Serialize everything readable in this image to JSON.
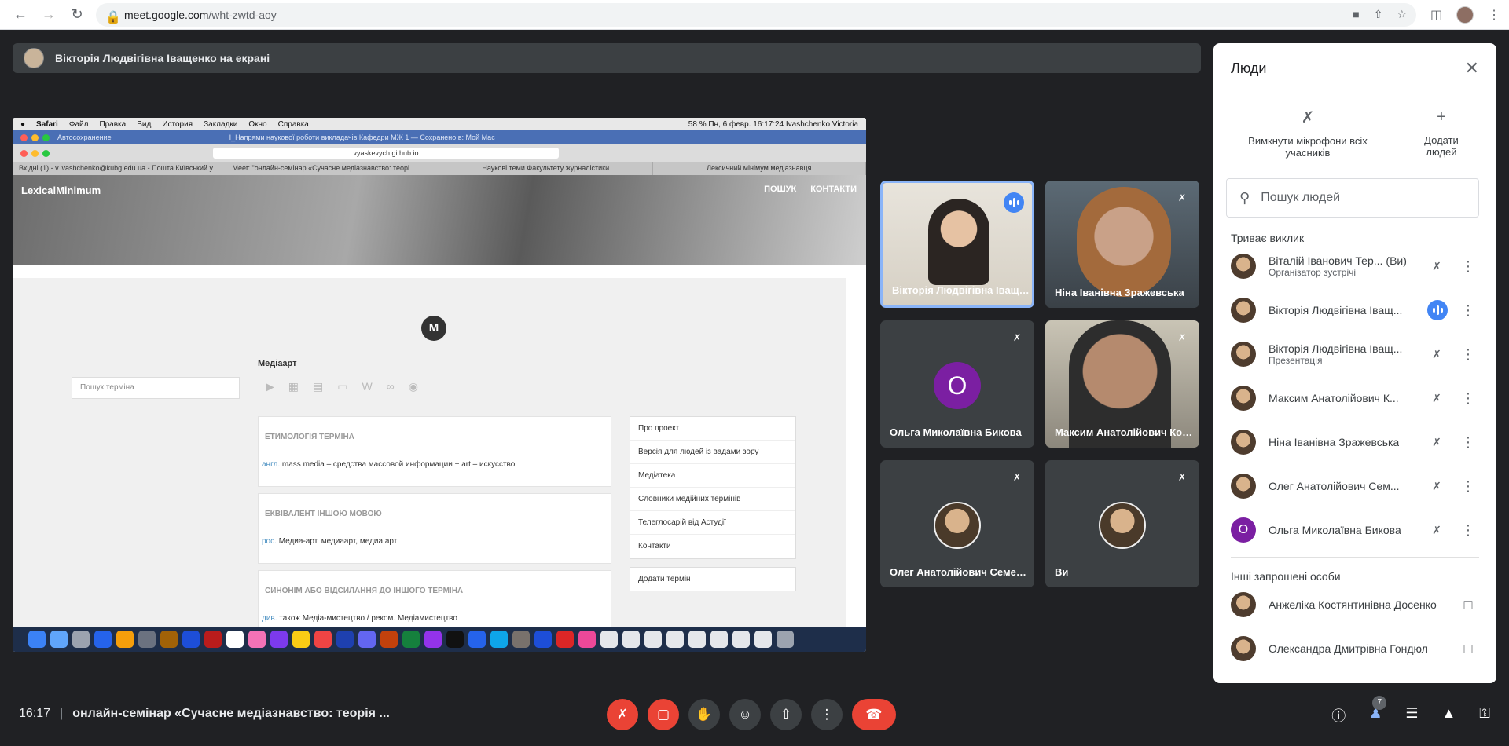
{
  "browser": {
    "url_host": "meet.google.com",
    "url_path": "/wht-zwtd-aoy"
  },
  "presenter": {
    "label": "Вікторія Людвігівна Іващенко на екрані"
  },
  "shared_screen": {
    "mac_menu": [
      "Safari",
      "Файл",
      "Правка",
      "Вид",
      "История",
      "Закладки",
      "Окно",
      "Справка"
    ],
    "mac_status": "58 %   Пн, 6 февр.  16:17:24   Ivashchenko Victoria",
    "doc_title": "І_Напрями наукової роботи викладачів Кафедри МЖ 1 — Сохранено в: Мой Mac",
    "autosave": "Автосохранение",
    "address": "vyaskevych.github.io",
    "tabs": [
      "Вхідні (1) - v.ivashchenko@kubg.edu.ua - Пошта Київський у...",
      "Meet: \"онлайн-семінар «Сучасне медіазнавство: теорі...",
      "Наукові теми Факультету журналістики",
      "Лексичний мінімум медіазнавця"
    ],
    "site_brand": "LexicalMinimum",
    "site_nav": [
      "ПОШУК",
      "КОНТАКТИ"
    ],
    "term_search_placeholder": "Пошук терміна",
    "avatar_letter": "M",
    "term_title": "Медіаарт",
    "cards": [
      {
        "heading": "ЕТИМОЛОГІЯ ТЕРМІНА",
        "lang": "англ.",
        "text": "mass media – средства массовой информации + art – искусство"
      },
      {
        "heading": "ЕКВІВАЛЕНТ ІНШОЮ МОВОЮ",
        "lang": "рос.",
        "text": "Медиа-арт, медиаарт, медиа арт"
      },
      {
        "heading": "СИНОНІМ АБО ВІДСИЛАННЯ ДО ІНШОГО ТЕРМІНА",
        "lang": "див.",
        "text": "також Медіа-мистецтво / реком. Медіамистецтво"
      }
    ],
    "side_menu": [
      "Про проект",
      "Версія для людей із вадами зору",
      "Медіатека",
      "Словники медійних термінів",
      "Телеглосарій від Астудії",
      "Контакти"
    ],
    "add_term": "Додати термін"
  },
  "tiles": [
    {
      "name": "Вікторія Людвігівна Іващенко",
      "state": "speaking"
    },
    {
      "name": "Ніна Іванівна Зражевська",
      "state": "muted"
    },
    {
      "name": "Ольга Миколаївна Бикова",
      "state": "muted",
      "letter": "О"
    },
    {
      "name": "Максим Анатолійович Коваль",
      "state": "muted"
    },
    {
      "name": "Олег Анатолійович Семенюк",
      "state": "muted"
    },
    {
      "name": "Ви",
      "state": "muted"
    }
  ],
  "people": {
    "title": "Люди",
    "mute_all": "Вимкнути мікрофони всіх учасників",
    "add_people": "Додати людей",
    "search_placeholder": "Пошук людей",
    "in_call_label": "Триває виклик",
    "in_call": [
      {
        "name": "Віталій Іванович Тер...",
        "you": "(Ви)",
        "sub": "Організатор зустрічі"
      },
      {
        "name": "Вікторія Людвігівна Іващ...",
        "sub": ""
      },
      {
        "name": "Вікторія Людвігівна Іващ...",
        "sub": "Презентація"
      },
      {
        "name": "Максим Анатолійович К...",
        "sub": ""
      },
      {
        "name": "Ніна Іванівна Зражевська",
        "sub": ""
      },
      {
        "name": "Олег Анатолійович Сем...",
        "sub": ""
      },
      {
        "name": "Ольга Миколаївна Бикова",
        "sub": "",
        "letter": "О"
      }
    ],
    "invited_label": "Інші запрошені особи",
    "invited": [
      {
        "name": "Анжеліка Костянтинівна Досенко"
      },
      {
        "name": "Олександра Дмитрівна Гондюл"
      }
    ]
  },
  "bottom": {
    "time": "16:17",
    "meeting_title": "онлайн-семінар «Сучасне медіазнавство: теорія ...",
    "people_count": "7"
  }
}
